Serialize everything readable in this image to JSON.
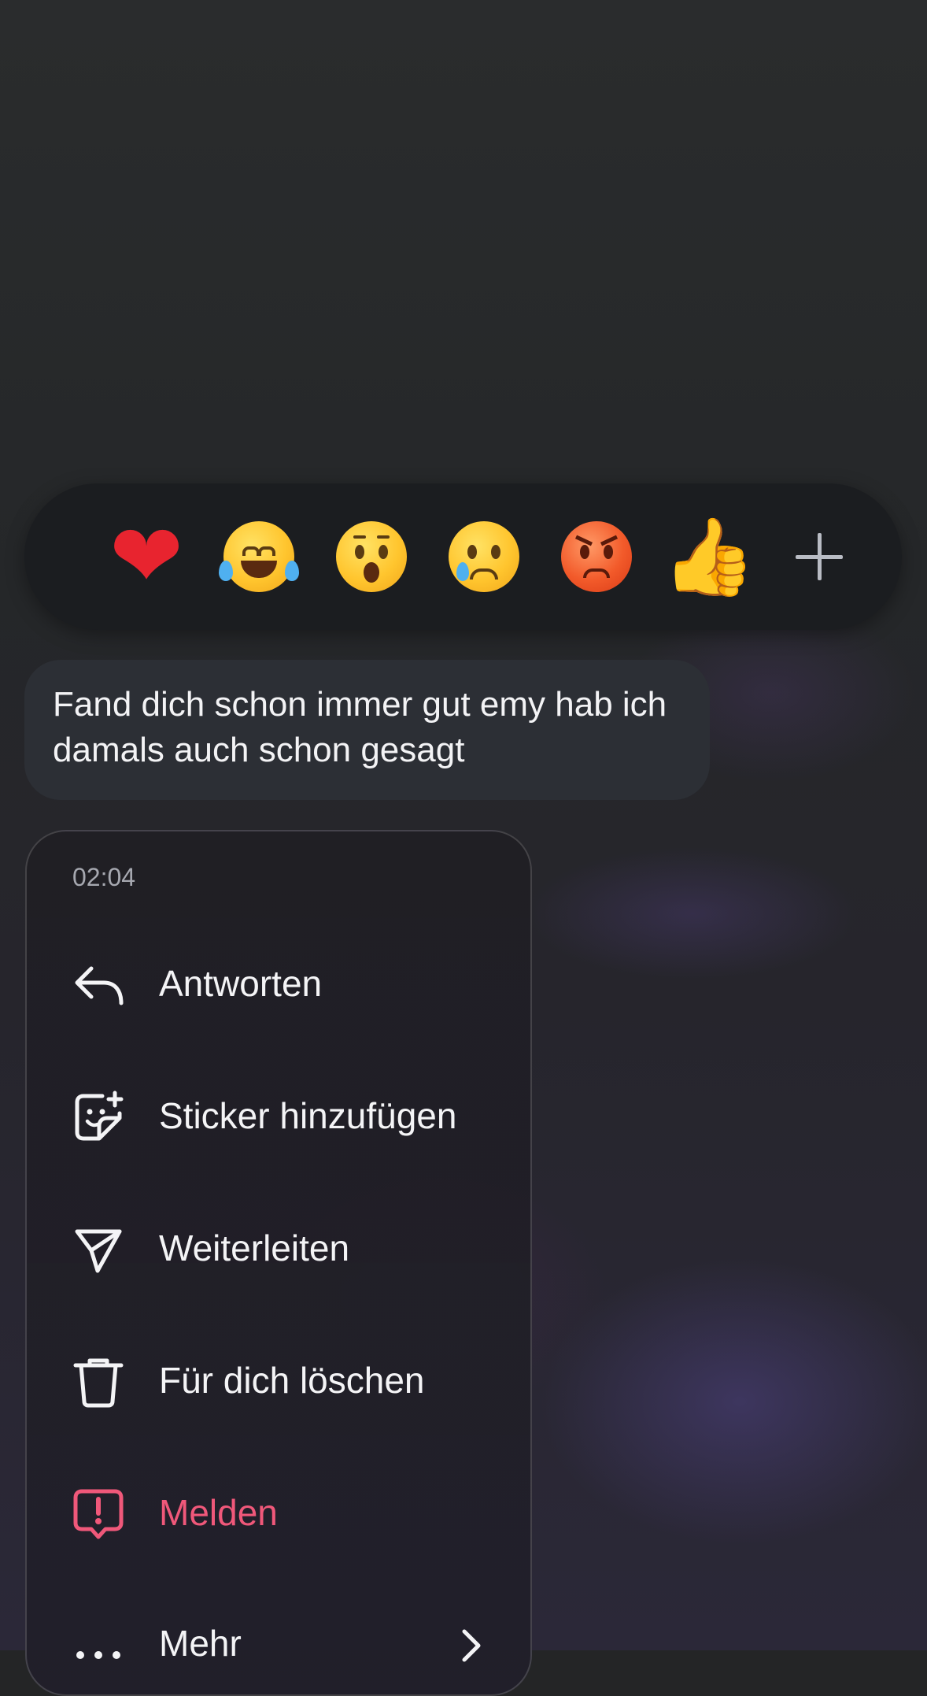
{
  "reactions": {
    "items": [
      {
        "name": "heart-emoji",
        "glyph": "❤"
      },
      {
        "name": "laughing-tears-emoji",
        "glyph": ""
      },
      {
        "name": "surprised-emoji",
        "glyph": ""
      },
      {
        "name": "crying-emoji",
        "glyph": ""
      },
      {
        "name": "angry-emoji",
        "glyph": ""
      },
      {
        "name": "thumbs-up-emoji",
        "glyph": "👍"
      }
    ],
    "more_icon": "plus-icon"
  },
  "message": {
    "text": "Fand dich schon immer gut emy hab ich damals auch schon gesagt"
  },
  "menu": {
    "time": "02:04",
    "items": [
      {
        "label": "Antworten",
        "icon": "reply-icon"
      },
      {
        "label": "Sticker hinzufügen",
        "icon": "sticker-add-icon"
      },
      {
        "label": "Weiterleiten",
        "icon": "forward-icon"
      },
      {
        "label": "Für dich löschen",
        "icon": "trash-icon"
      },
      {
        "label": "Melden",
        "icon": "report-icon",
        "color": "#f0587a"
      },
      {
        "label": "Mehr",
        "icon": "more-icon"
      }
    ]
  }
}
